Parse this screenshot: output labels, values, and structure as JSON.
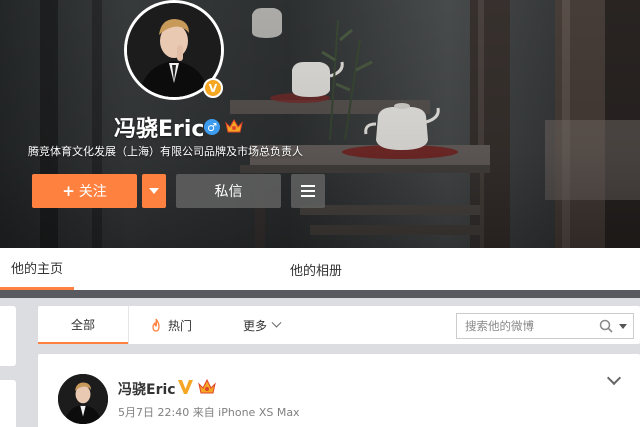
{
  "profile": {
    "name": "冯骁Eric",
    "description": "腾竞体育文化发展（上海）有限公司品牌及市场总负责人",
    "verified_icon": "verified-v-icon",
    "gender_icon": "male-icon",
    "member_icon": "crown-icon"
  },
  "actions": {
    "follow_plus": "+",
    "follow_label": "关注",
    "message_label": "私信"
  },
  "tabs": {
    "home": "他的主页",
    "album": "他的相册"
  },
  "feed_filters": {
    "all": "全部",
    "hot": "热门",
    "more": "更多"
  },
  "search": {
    "placeholder": "搜索他的微博",
    "value": ""
  },
  "post": {
    "author": "冯骁Eric",
    "meta": "5月7日 22:40 来自 iPhone XS Max"
  },
  "colors": {
    "accent": "#ff8140",
    "verify": "#f5a623",
    "gender": "#3d9bf0"
  }
}
